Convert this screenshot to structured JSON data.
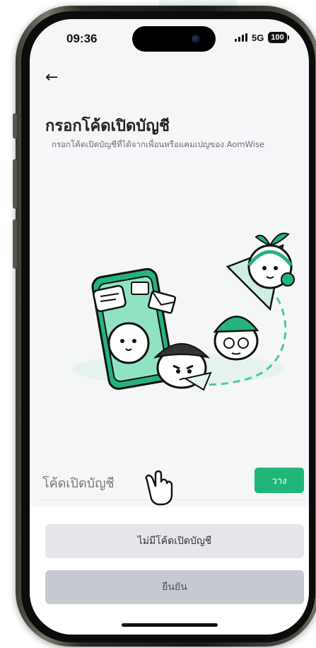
{
  "status_bar": {
    "time": "09:36",
    "network": "5G",
    "battery": "100"
  },
  "header": {
    "back_icon": "arrow-left-icon",
    "title": "กรอกโค้ดเปิดบัญชี",
    "subtitle": "กรอกโค้ดเปิดบัญชีที่ได้จากเพื่อนหรือแคมเปญของ AomWise"
  },
  "form": {
    "code_placeholder": "โค้ดเปิดบัญชี",
    "code_value": "",
    "paste_label": "วาง"
  },
  "actions": {
    "no_code_label": "ไม่มีโค้ดเปิดบัญชี",
    "confirm_label": "ยืนยัน"
  },
  "colors": {
    "accent": "#20b67a",
    "screen_bg": "#f5f6f8",
    "disabled_button": "#c5c9d0"
  }
}
